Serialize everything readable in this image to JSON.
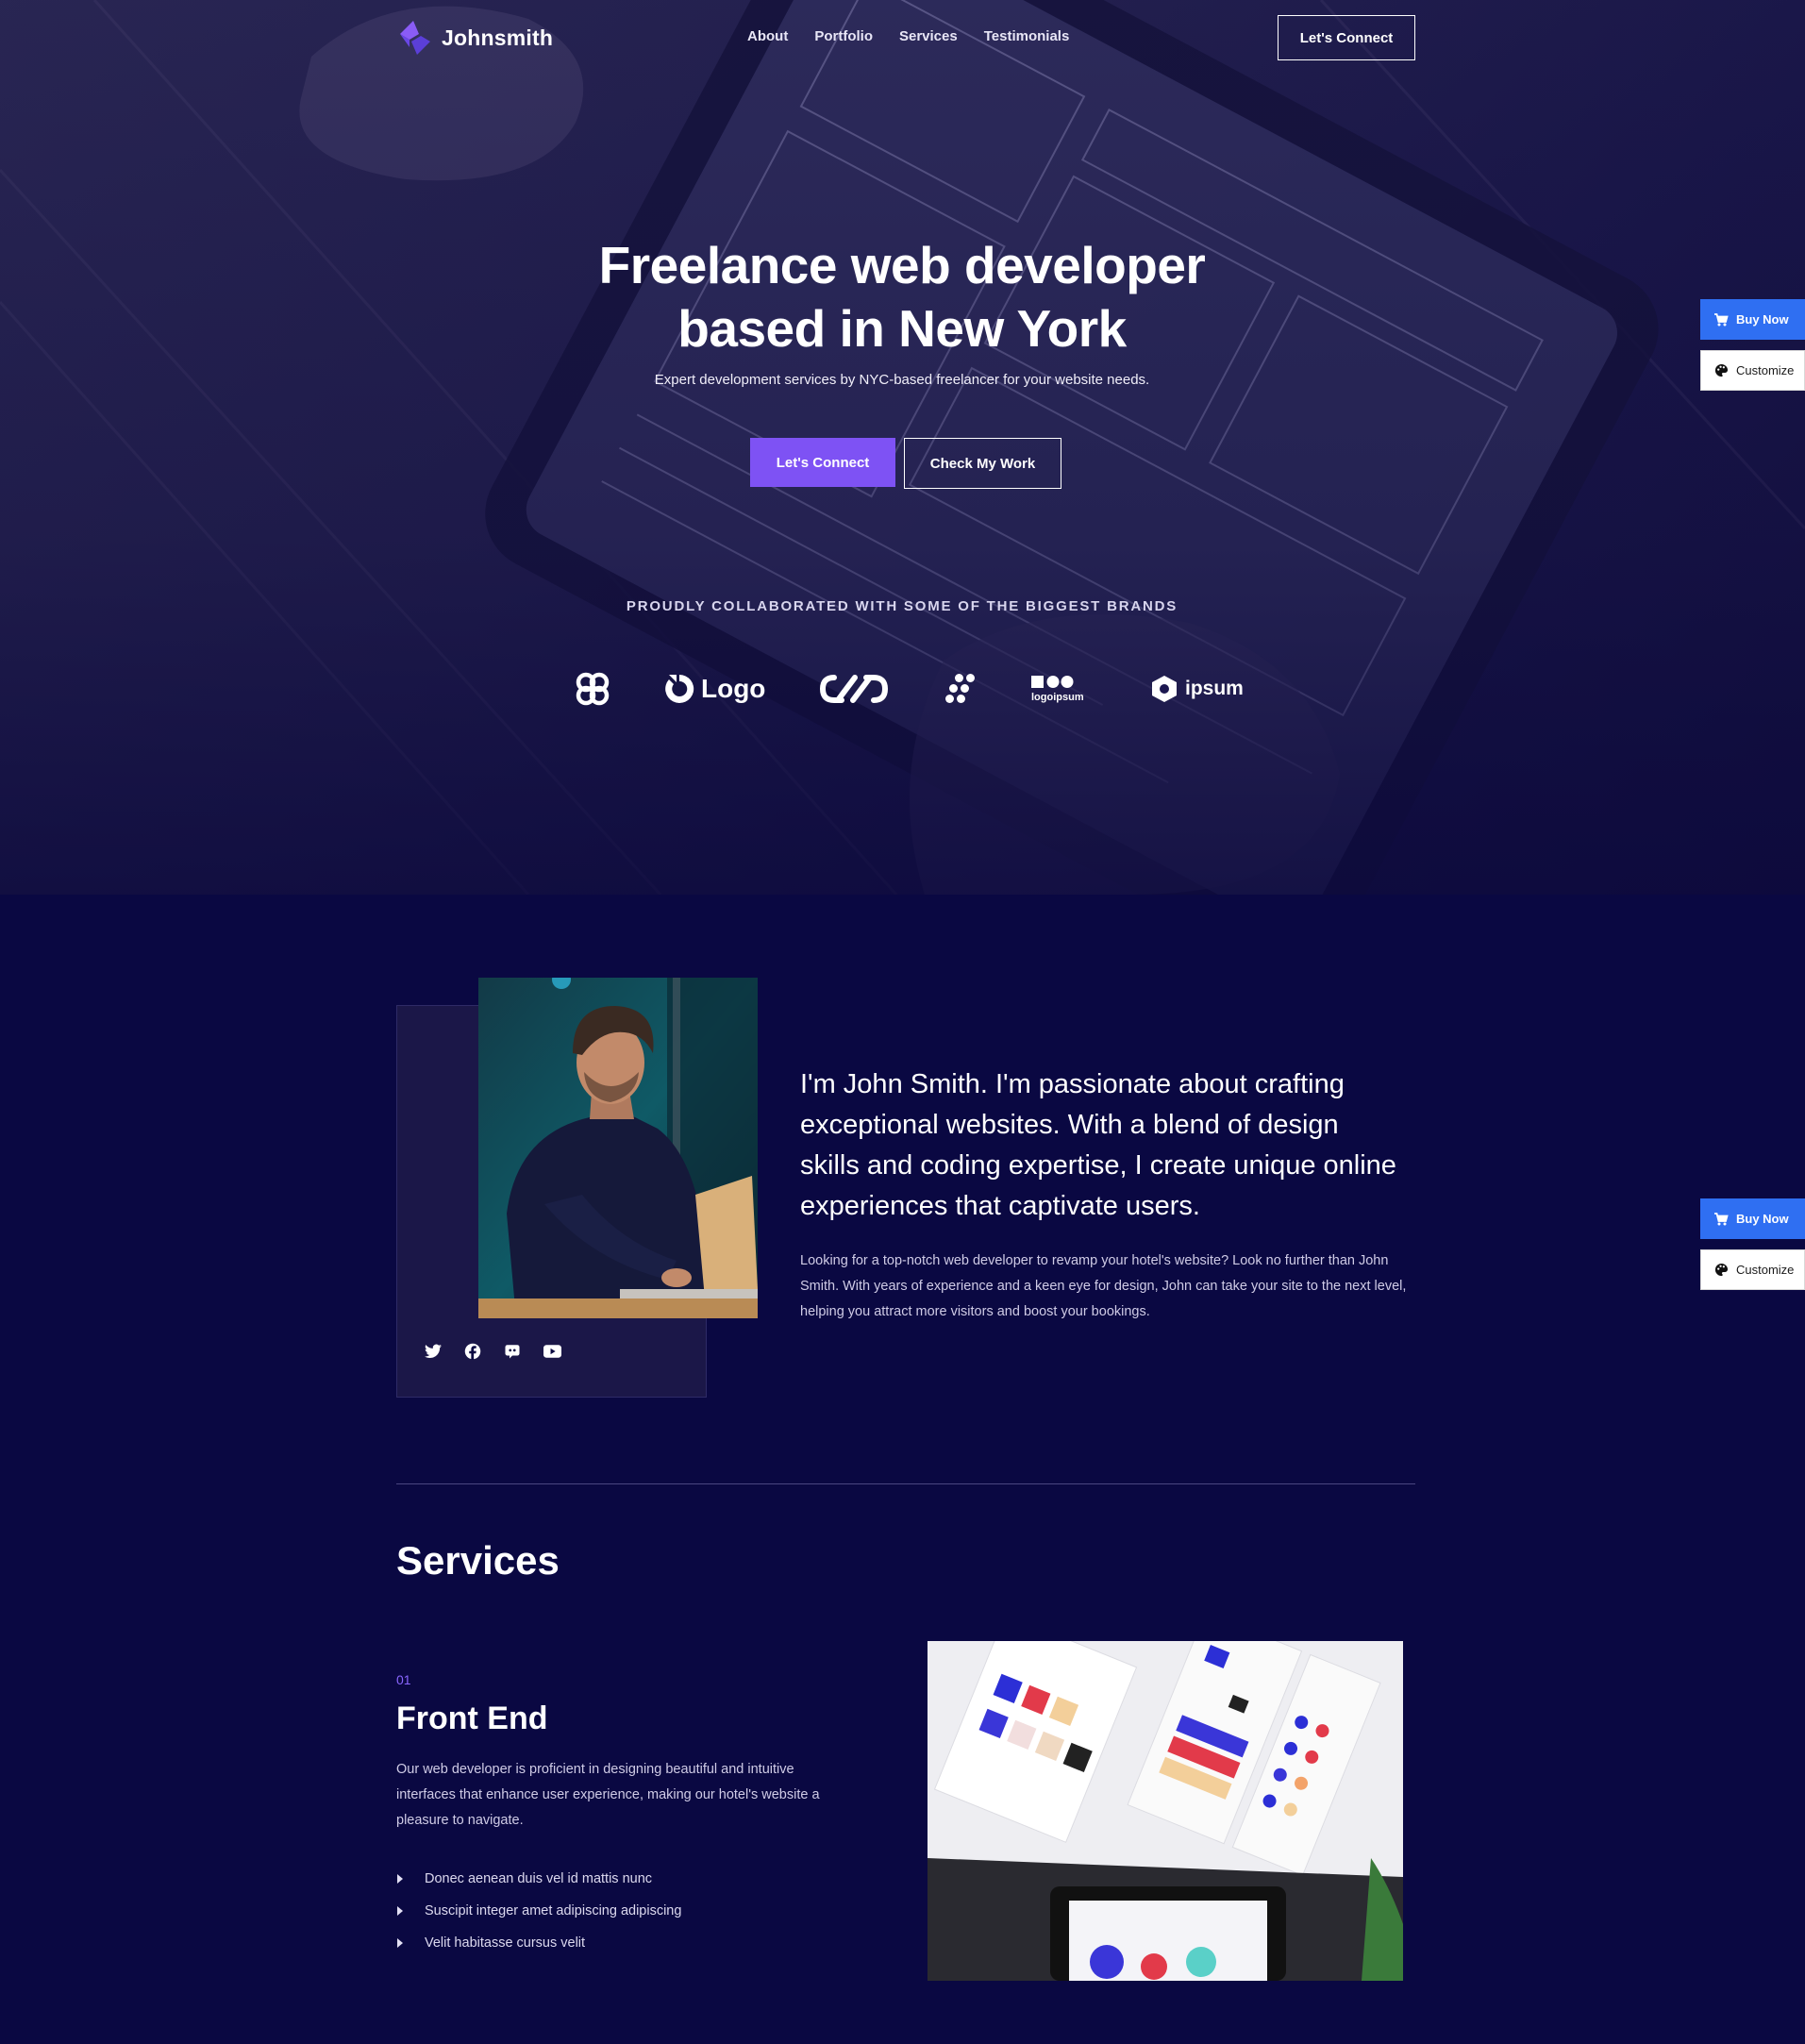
{
  "nav": {
    "brand": "Johnsmith",
    "items": [
      "About",
      "Portfolio",
      "Services",
      "Testimonials"
    ],
    "cta": "Let's Connect"
  },
  "hero": {
    "title_line1": "Freelance web developer",
    "title_line2": "based in New York",
    "subtitle": "Expert development services by NYC-based freelancer for your website needs.",
    "primary_button": "Let's Connect",
    "secondary_button": "Check My Work",
    "brands_heading": "PROUDLY COLLABORATED WITH SOME OF THE BIGGEST BRANDS",
    "brand_logos": [
      {
        "icon": "clover-logo-icon",
        "text": ""
      },
      {
        "icon": "ring-logo-icon",
        "text": "Logo"
      },
      {
        "icon": "infinity-logo-icon",
        "text": ""
      },
      {
        "icon": "dots-logo-icon",
        "text": ""
      },
      {
        "icon": "blocks-logo-icon",
        "text": "logoipsum"
      },
      {
        "icon": "hexagon-logo-icon",
        "text": "ipsum"
      }
    ]
  },
  "side_buttons": {
    "buy": "Buy Now",
    "customize": "Customize"
  },
  "about": {
    "lead": "I'm John Smith. I'm passionate about crafting exceptional websites. With a blend of design skills and coding expertise, I create unique online experiences that captivate users.",
    "body": "Looking for a top-notch web developer to revamp your hotel's website? Look no further than John Smith. With years of experience and a keen eye for design, John can take your site to the next level, helping you attract more visitors and boost your bookings.",
    "socials": [
      "twitter-icon",
      "facebook-icon",
      "discord-icon",
      "youtube-icon"
    ]
  },
  "services": {
    "heading": "Services",
    "items": [
      {
        "index": "01",
        "title": "Front End",
        "description": "Our web developer is proficient in designing beautiful and intuitive interfaces that enhance user experience, making our hotel's website a pleasure to navigate.",
        "bullets": [
          "Donec aenean duis vel id mattis nunc",
          "Suscipit integer amet adipiscing adipiscing",
          "Velit habitasse cursus velit"
        ]
      }
    ]
  },
  "colors": {
    "background": "#0a0842",
    "accent": "#7e52f4",
    "buy_button": "#2f6ff2"
  }
}
